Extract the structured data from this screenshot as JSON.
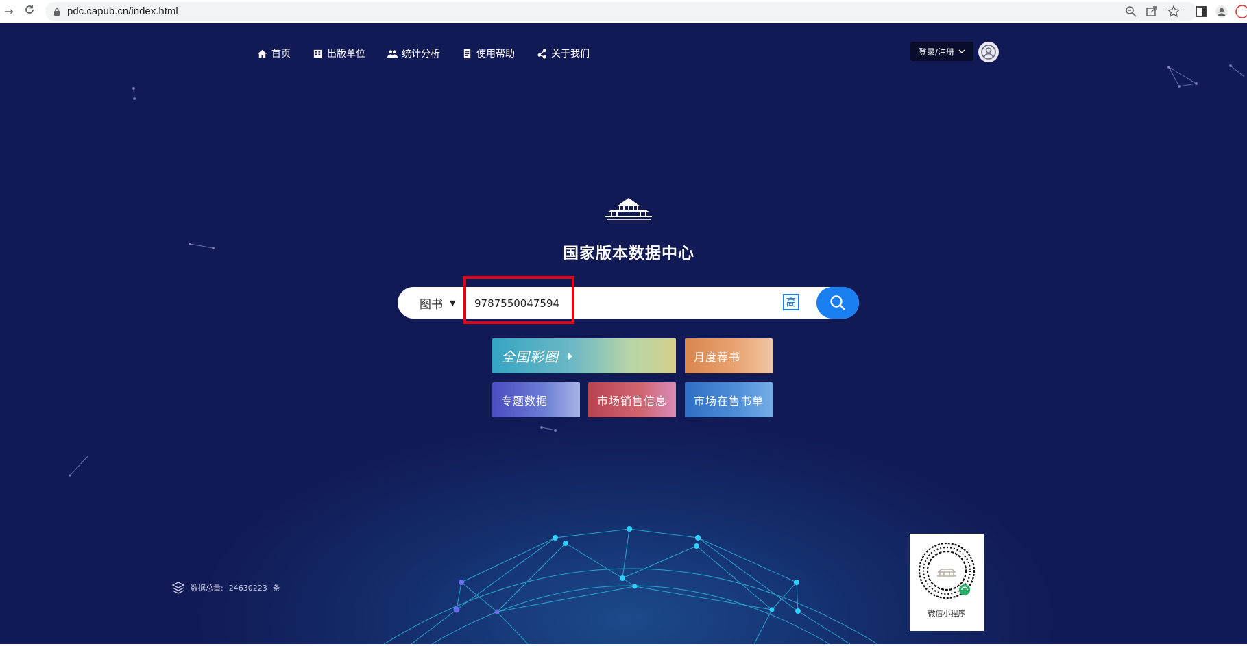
{
  "browser": {
    "url": "pdc.capub.cn/index.html"
  },
  "nav": {
    "items": [
      {
        "label": "首页",
        "icon": "home-icon"
      },
      {
        "label": "出版单位",
        "icon": "building-icon"
      },
      {
        "label": "统计分析",
        "icon": "users-icon"
      },
      {
        "label": "使用帮助",
        "icon": "document-icon"
      },
      {
        "label": "关于我们",
        "icon": "share-icon"
      }
    ],
    "login_label": "登录/注册"
  },
  "hero": {
    "title": "国家版本数据中心"
  },
  "search": {
    "type_label": "图书",
    "value": "9787550047594",
    "advanced_label": "高"
  },
  "tiles": {
    "national": "全国彩图",
    "monthly": "月度荐书",
    "topic": "专题数据",
    "sales": "市场销售信息",
    "onsale": "市场在售书单"
  },
  "stats": {
    "label": "数据总量:",
    "count": "24630223",
    "unit": "条"
  },
  "qr": {
    "label": "微信小程序"
  },
  "colors": {
    "accent": "#1a7ff0",
    "highlight": "#e60012",
    "background": "#111a55"
  }
}
